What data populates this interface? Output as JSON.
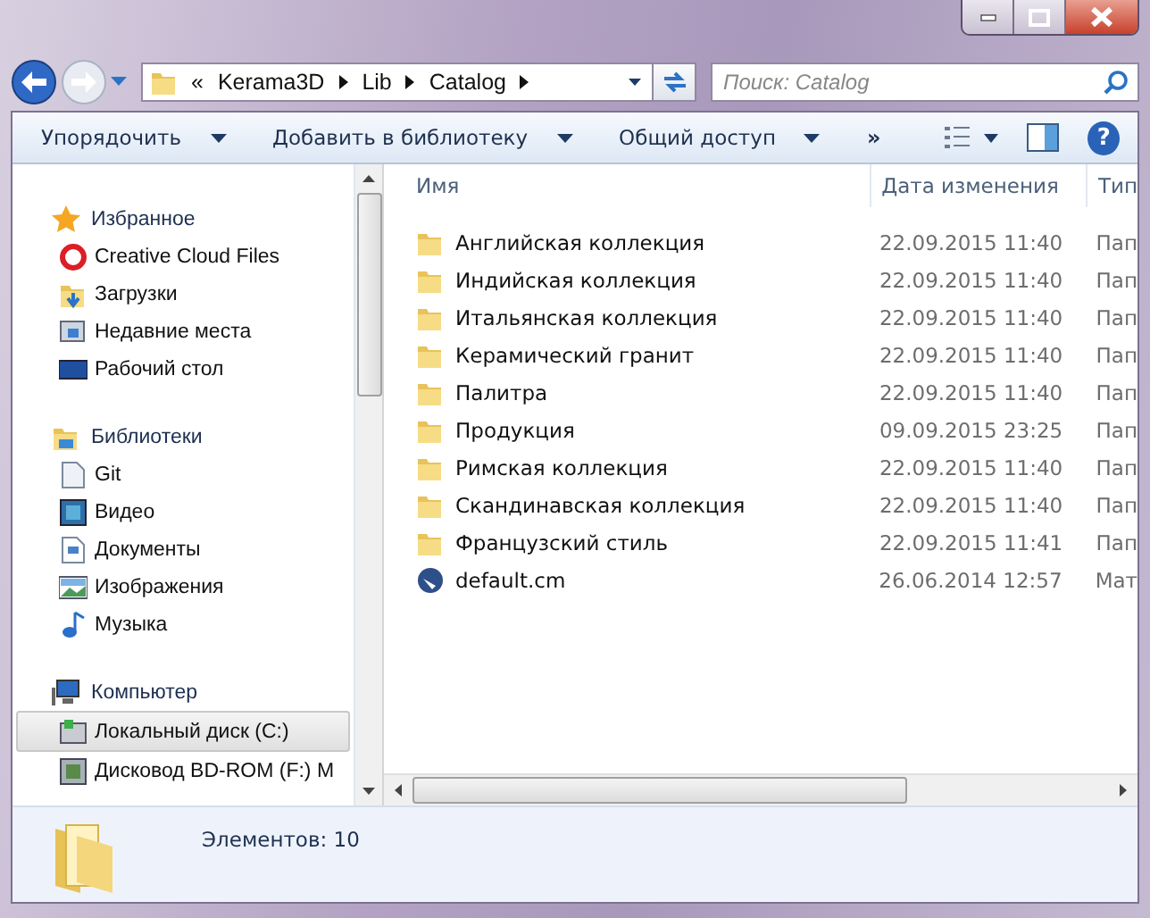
{
  "address_bar": {
    "overflow": "«",
    "path": [
      "Kerama3D",
      "Lib",
      "Catalog"
    ]
  },
  "search": {
    "placeholder": "Поиск: Catalog"
  },
  "toolbar": {
    "buttons": [
      {
        "label": "Упорядочить",
        "menu": true
      },
      {
        "label": "Добавить в библиотеку",
        "menu": true
      },
      {
        "label": "Общий доступ",
        "menu": true
      }
    ],
    "more": "»",
    "help": "?"
  },
  "sidebar": {
    "groups": [
      {
        "label": "Избранное",
        "children": [
          {
            "label": "Creative Cloud Files",
            "selected": false
          },
          {
            "label": "Загрузки",
            "selected": false
          },
          {
            "label": "Недавние места",
            "selected": false
          },
          {
            "label": "Рабочий стол",
            "selected": false
          }
        ]
      },
      {
        "label": "Библиотеки",
        "children": [
          {
            "label": "Git",
            "selected": false
          },
          {
            "label": "Видео",
            "selected": false
          },
          {
            "label": "Документы",
            "selected": false
          },
          {
            "label": "Изображения",
            "selected": false
          },
          {
            "label": "Музыка",
            "selected": false
          }
        ]
      },
      {
        "label": "Компьютер",
        "children": [
          {
            "label": "Локальный диск (C:)",
            "selected": true
          },
          {
            "label": "Дисковод BD-ROM (F:) M",
            "selected": false
          }
        ]
      }
    ]
  },
  "table": {
    "columns": [
      "Имя",
      "Дата изменения",
      "Тип"
    ],
    "rows": [
      {
        "kind": "folder",
        "name": "Английская коллекция",
        "date": "22.09.2015 11:40",
        "type": "Пап"
      },
      {
        "kind": "folder",
        "name": "Индийская коллекция",
        "date": "22.09.2015 11:40",
        "type": "Пап"
      },
      {
        "kind": "folder",
        "name": "Итальянская коллекция",
        "date": "22.09.2015 11:40",
        "type": "Пап"
      },
      {
        "kind": "folder",
        "name": "Керамический гранит",
        "date": "22.09.2015 11:40",
        "type": "Пап"
      },
      {
        "kind": "folder",
        "name": "Палитра",
        "date": "22.09.2015 11:40",
        "type": "Пап"
      },
      {
        "kind": "folder",
        "name": "Продукция",
        "date": "09.09.2015 23:25",
        "type": "Пап"
      },
      {
        "kind": "folder",
        "name": "Римская коллекция",
        "date": "22.09.2015 11:40",
        "type": "Пап"
      },
      {
        "kind": "folder",
        "name": "Скандинавская коллекция",
        "date": "22.09.2015 11:40",
        "type": "Пап"
      },
      {
        "kind": "folder",
        "name": "Французский стиль",
        "date": "22.09.2015 11:41",
        "type": "Пап"
      },
      {
        "kind": "file",
        "name": "default.cm",
        "date": "26.06.2014 12:57",
        "type": "Мат"
      }
    ]
  },
  "status_bar": {
    "count": "Элементов: 10"
  }
}
